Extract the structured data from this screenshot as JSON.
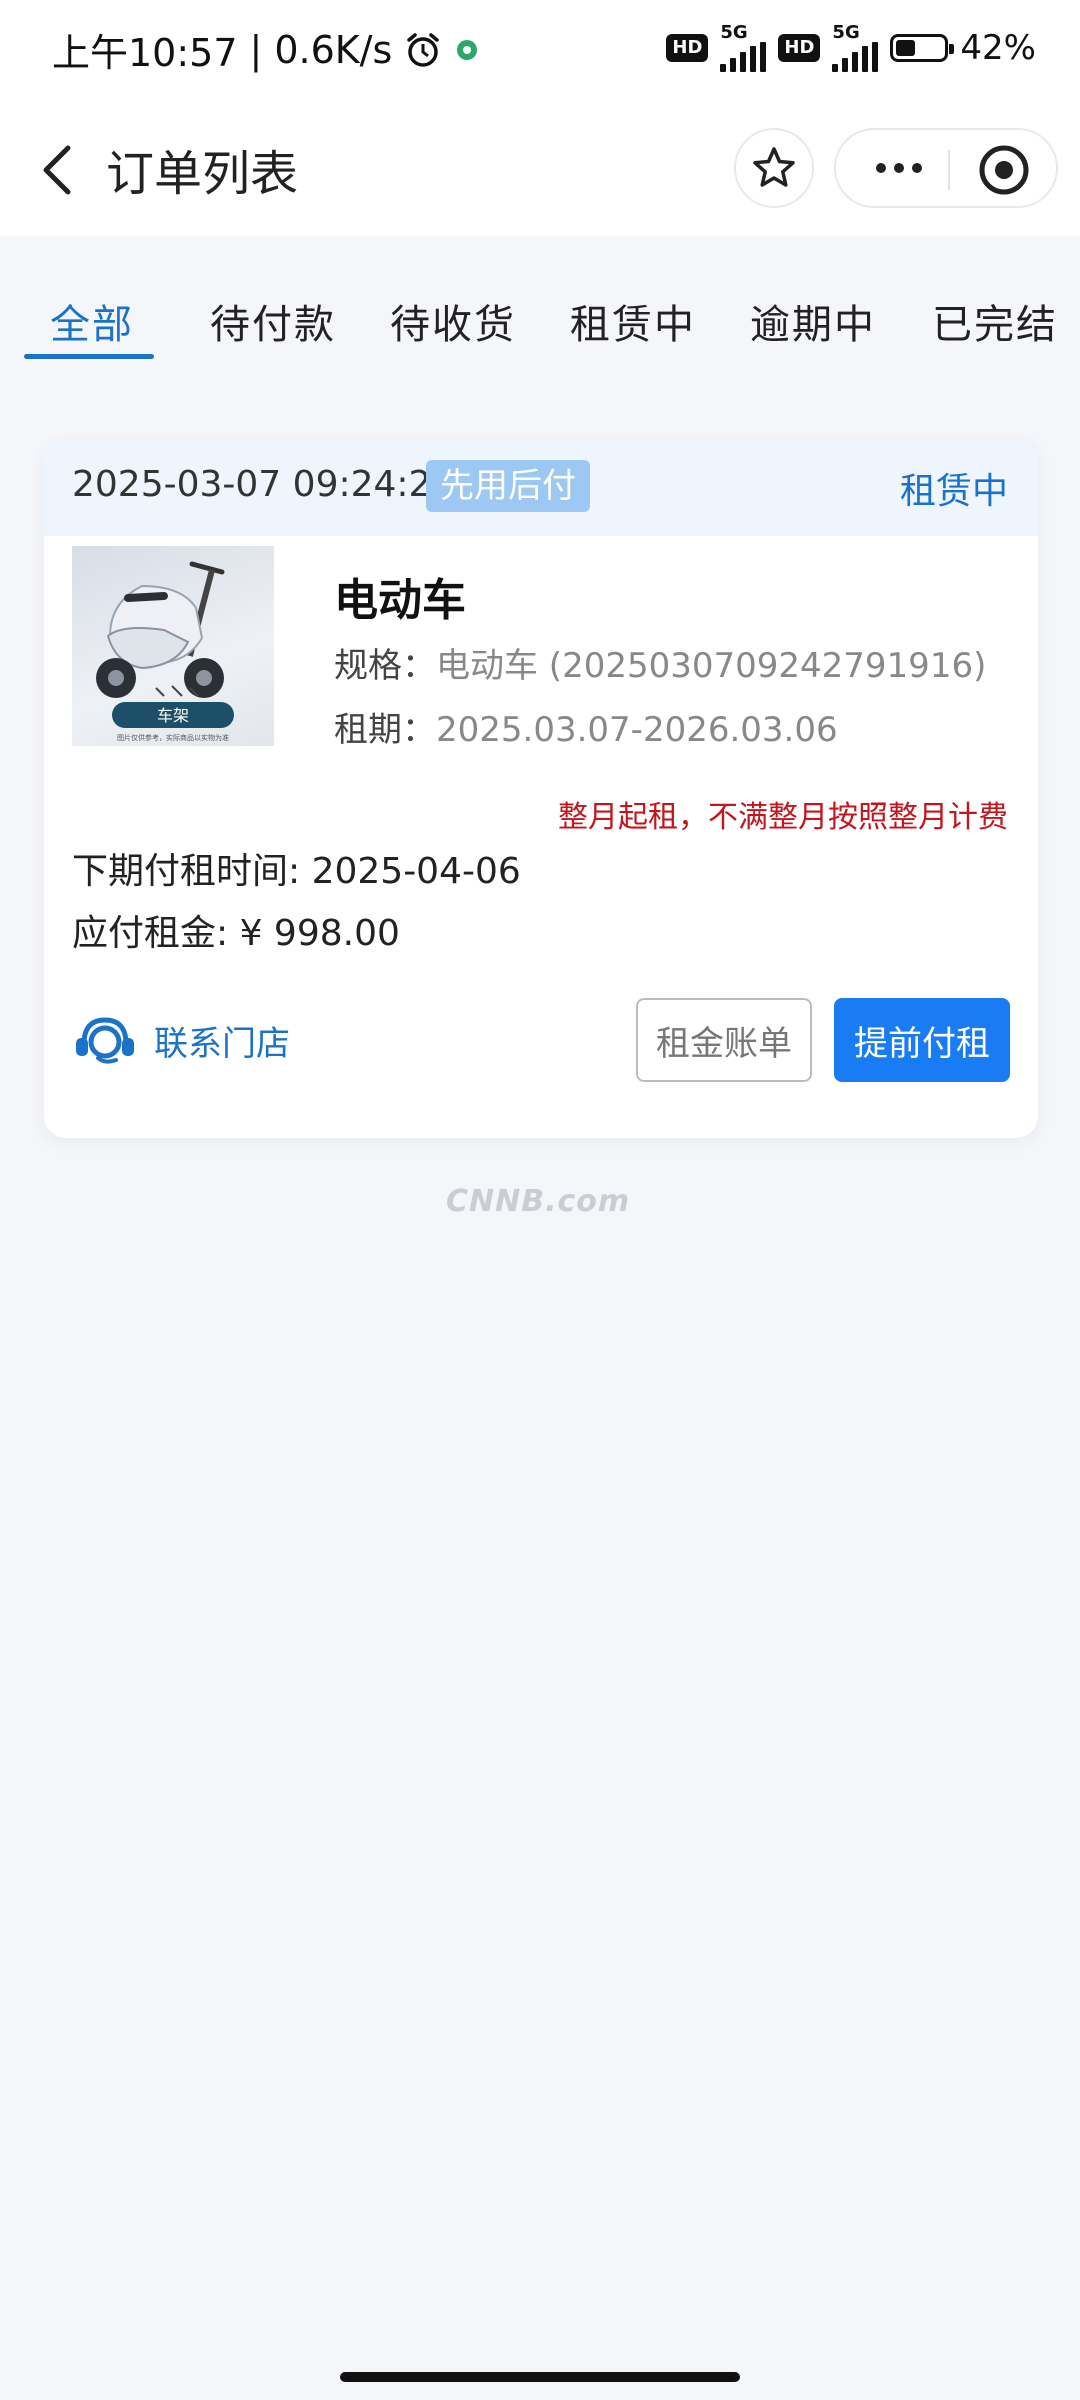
{
  "status_bar": {
    "time": "上午10:57",
    "net_speed": "0.6K/s",
    "hd1": "HD",
    "signal1": "5G",
    "hd2": "HD",
    "signal2": "5G",
    "battery": "42%",
    "battery_level": 0.42
  },
  "nav": {
    "title": "订单列表",
    "back_icon": "chevron-left-icon",
    "star_icon": "star-icon",
    "more_icon": "more-dots-icon",
    "target_icon": "target-icon"
  },
  "tabs": [
    {
      "label": "全部",
      "active": true
    },
    {
      "label": "待付款",
      "active": false
    },
    {
      "label": "待收货",
      "active": false
    },
    {
      "label": "租赁中",
      "active": false
    },
    {
      "label": "逾期中",
      "active": false
    },
    {
      "label": "已完结",
      "active": false
    }
  ],
  "order": {
    "time": "2025-03-07 09:24:27",
    "pay_tag": "先用后付",
    "status": "租赁中",
    "product": {
      "name": "电动车",
      "image_label": "车架",
      "image_caption": "图片仅供参考，实际商品以实物为准",
      "spec_label": "规格：",
      "spec_value": "电动车 (2025030709242791916)",
      "term_label": "租期：",
      "term_value": "2025.03.07-2026.03.06"
    },
    "notice": "整月起租，不满整月按照整月计费",
    "next_pay": "下期付租时间: 2025-04-06",
    "amount": "应付租金: ¥ 998.00",
    "contact_label": "联系门店",
    "bill_button": "租金账单",
    "prepay_button": "提前付租"
  },
  "watermark": "CNNB.com",
  "colors": {
    "accent": "#1a73c8",
    "primary_button": "#1a7cf5",
    "notice_red": "#c4151c",
    "tag_blue": "#9cc8f3",
    "background": "#f5f6fa"
  }
}
